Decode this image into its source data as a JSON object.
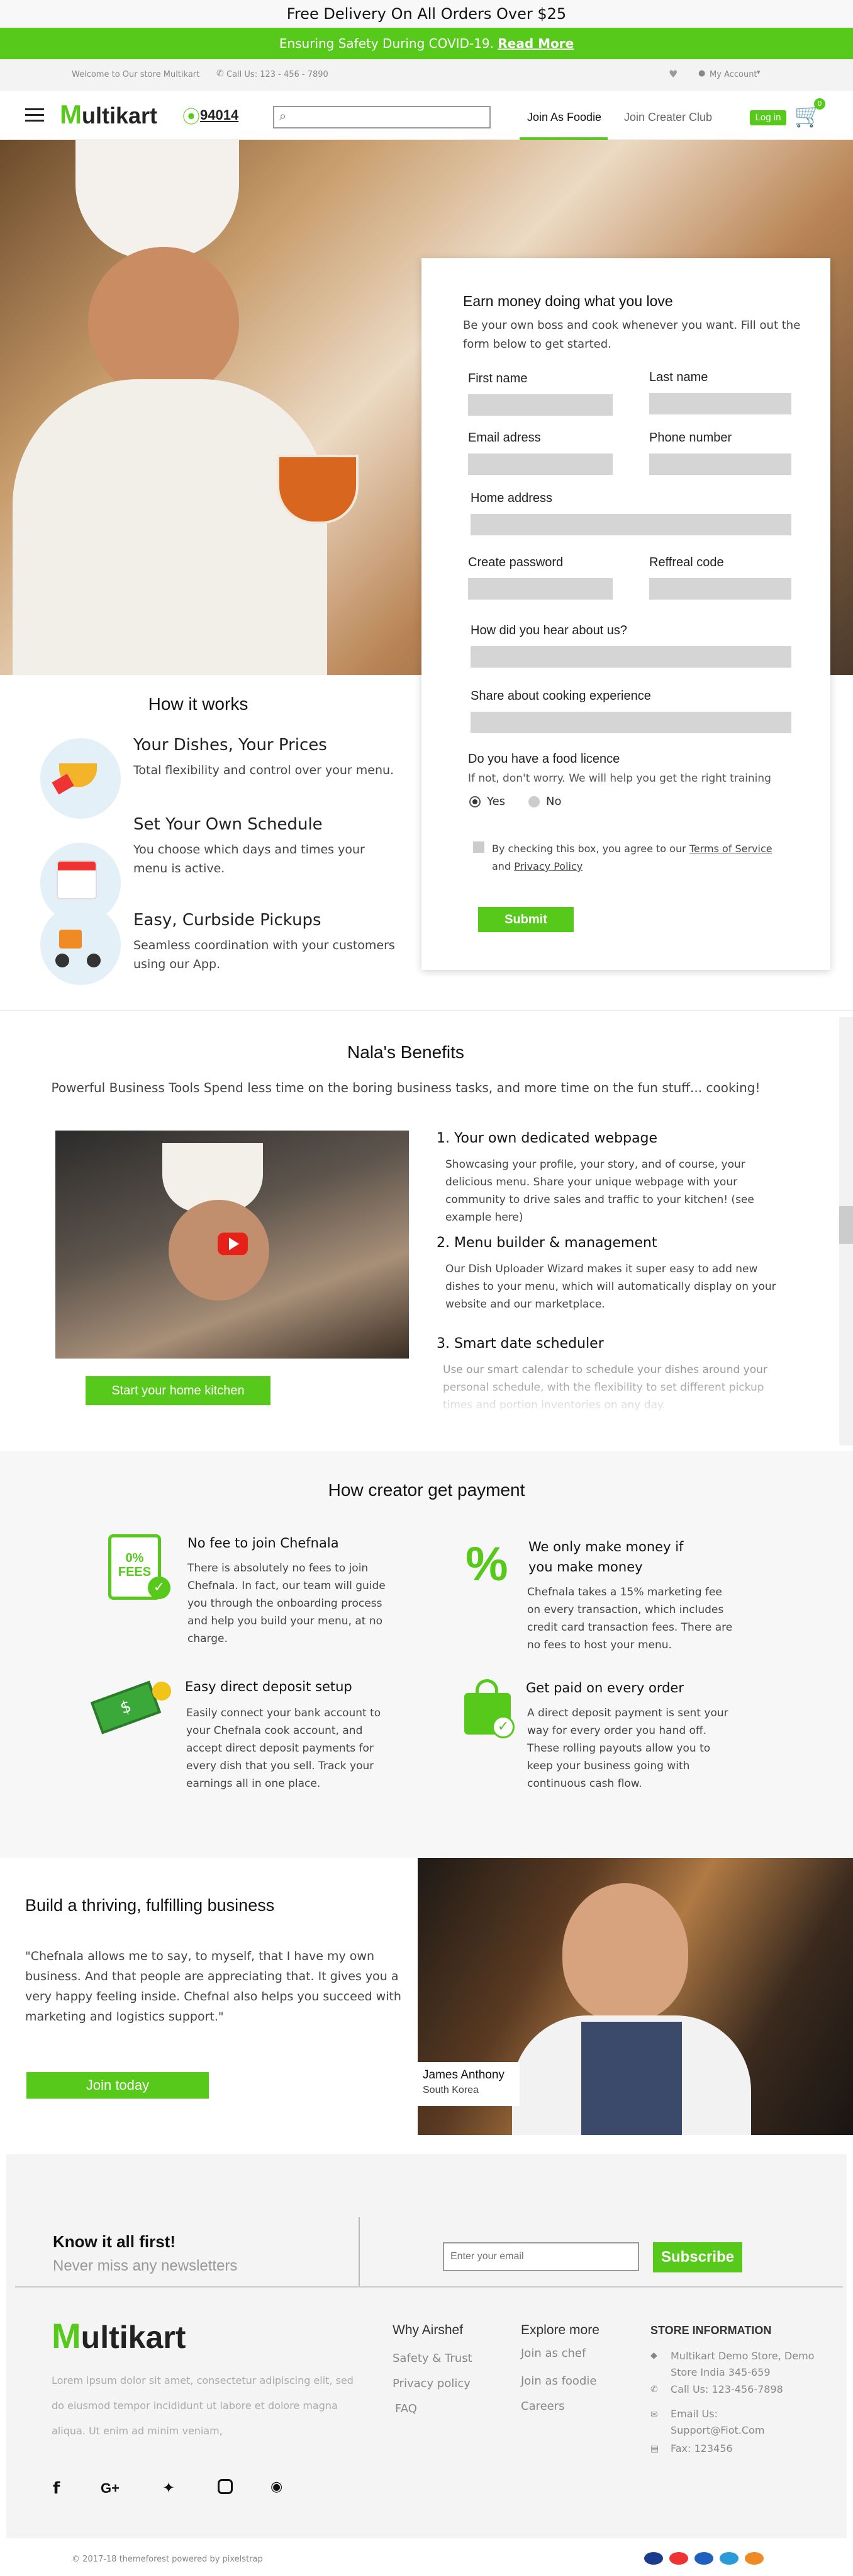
{
  "promo": {
    "text": "Free Delivery On All Orders Over $25"
  },
  "covid": {
    "text": "Ensuring Safety During COVID-19.",
    "link": "Read More"
  },
  "infobar": {
    "welcome": "Welcome to Our store Multikart",
    "call": "Call Us: 123 - 456 - 7890",
    "account": "My Account"
  },
  "header": {
    "logo_m": "M",
    "logo_rest": "ultikart",
    "zip": "94014",
    "search_placeholder": "",
    "nav": [
      "Join As Foodie",
      "Join Creater Club"
    ],
    "login": "Log in",
    "cart_count": "0"
  },
  "form": {
    "title": "Earn money doing what you love",
    "subtitle": "Be your own boss and cook whenever you want. Fill out the form below to get started.",
    "first_name": "First name",
    "last_name": "Last name",
    "email": "Email adress",
    "phone": "Phone number",
    "home_address": "Home address",
    "password": "Create password",
    "referral": "Reffreal code",
    "hear": "How did you hear about us?",
    "share": "Share about cooking experience",
    "licence_q": "Do you have a food licence",
    "licence_sub": "If not, don't worry. We will help you get the right training",
    "yes": "Yes",
    "no": "No",
    "agree": "By checking this box, you agree to our",
    "tos": "Terms of Service",
    "and": "and",
    "privacy": "Privacy Policy",
    "submit": "Submit"
  },
  "how": {
    "title": "How it works",
    "items": [
      {
        "title": "Your Dishes, Your Prices",
        "text": "Total flexibility and control over your menu."
      },
      {
        "title": "Set Your Own Schedule",
        "text": "You choose which days and times your menu is active."
      },
      {
        "title": "Easy, Curbside Pickups",
        "text": "Seamless coordination with your customers using our App."
      }
    ]
  },
  "benefits": {
    "title": "Nala's Benefits",
    "subtitle": "Powerful Business Tools Spend less time on the boring business tasks, and more time on the fun stuff... cooking!",
    "items": [
      {
        "title": "1. Your own dedicated webpage",
        "text": "Showcasing your profile, your story, and of course, your delicious menu. Share your unique webpage with your community to drive sales and traffic to your kitchen! (see example here)"
      },
      {
        "title": "2. Menu builder & management",
        "text": "Our Dish Uploader Wizard makes it super easy to add new dishes to your menu, which will automatically display on your website and our marketplace."
      },
      {
        "title": "3. Smart date scheduler",
        "text": "Use our smart calendar to schedule your dishes around your personal schedule, with the flexibility to set different pickup times and portion inventories on any day."
      }
    ],
    "button": "Start your home kitchen"
  },
  "payment": {
    "title": "How creator get payment",
    "fee_badge": "0% FEES",
    "items": [
      {
        "title": "No fee to join Chefnala",
        "text": "There is absolutely no fees to join Chefnala. In fact, our team will guide you through the onboarding process and help you build your menu, at no charge."
      },
      {
        "title": "We only make money if you make money",
        "text": "Chefnala takes a 15% marketing fee on every transaction, which includes credit card transaction fees. There are no fees to host your menu."
      },
      {
        "title": "Easy direct deposit setup",
        "text": "Easily connect your bank account to your Chefnala cook account, and accept direct deposit payments for every dish that you sell. Track your earnings all in one place."
      },
      {
        "title": "Get paid on every order",
        "text": "A direct deposit payment is sent your way for every order you hand off. These rolling payouts allow you to keep your business going with continuous cash flow."
      }
    ]
  },
  "build": {
    "title": "Build a thriving, fulfilling business",
    "quote": "\"Chefnala allows me to say, to myself, that I have my own business. And that people are appreciating that. It gives you a very happy feeling inside. Chefnal also helps you succeed with marketing and logistics support.\"",
    "button": "Join today",
    "name": "James Anthony",
    "place": "South Korea"
  },
  "newsletter": {
    "title": "Know it all first!",
    "subtitle": "Never miss any newsletters",
    "placeholder": "Enter your email",
    "button": "Subscribe"
  },
  "footer": {
    "about": "Lorem ipsum dolor sit amet, consectetur adipiscing elit, sed do eiusmod tempor incididunt ut labore et dolore magna aliqua. Ut enim ad minim veniam,",
    "col1_title": "Why Airshef",
    "col1": [
      "Safety & Trust",
      "Privacy policy",
      "FAQ"
    ],
    "col2_title": "Explore more",
    "col2": [
      "Join as chef",
      "Join as foodie",
      "Careers"
    ],
    "store_title": "STORE INFORMATION",
    "store_addr": "Multikart Demo Store, Demo Store India 345-659",
    "store_call": "Call Us: 123-456-7898",
    "store_email": "Email Us: Support@Fiot.Com",
    "store_fax": "Fax: 123456",
    "copyright": "© 2017-18 themeforest powered by pixelstrap"
  },
  "colors": {
    "accent": "#56c91a"
  }
}
